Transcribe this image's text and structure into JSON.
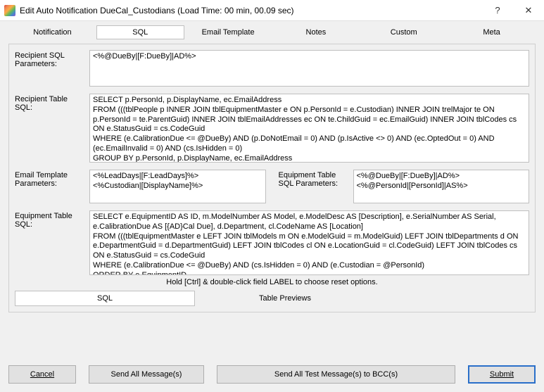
{
  "titlebar": {
    "title": "Edit Auto Notification DueCal_Custodians (Load Time: 00 min, 00.09 sec)",
    "help": "?",
    "close": "✕"
  },
  "tabs": {
    "notification": "Notification",
    "sql": "SQL",
    "email_template": "Email Template",
    "notes": "Notes",
    "custom": "Custom",
    "meta": "Meta"
  },
  "fields": {
    "recip_sql_params_label": "Recipient SQL Parameters:",
    "recip_sql_params_value": "<%@DueBy|[F:DueBy]|AD%>",
    "recip_table_sql_label": "Recipient Table SQL:",
    "recip_table_sql_value": "SELECT p.PersonId, p.DisplayName, ec.EmailAddress\nFROM (((tblPeople p INNER JOIN tblEquipmentMaster e ON p.PersonId = e.Custodian) INNER JOIN trelMajor te ON p.PersonId = te.ParentGuid) INNER JOIN tblEmailAddresses ec ON te.ChildGuid = ec.EmailGuid) INNER JOIN tblCodes cs ON e.StatusGuid = cs.CodeGuid\nWHERE (e.CalibrationDue <= @DueBy) AND (p.DoNotEmail = 0) AND (p.IsActive <> 0) AND (ec.OptedOut = 0) AND (ec.EmailInvalid = 0) AND (cs.IsHidden = 0)\nGROUP BY p.PersonId, p.DisplayName, ec.EmailAddress\nHAVING ec.EmailAddress IS NOT NULL\nORDER BY p.DisplayName",
    "email_tmpl_params_label": "Email Template Parameters:",
    "email_tmpl_params_value": "<%LeadDays|[F:LeadDays]%>\n<%Custodian|[DisplayName]%>",
    "equip_sql_params_label": "Equipment Table SQL Parameters:",
    "equip_sql_params_value": "<%@DueBy|[F:DueBy]|AD%>\n<%@PersonId|[PersonId]|AS%>",
    "equip_table_sql_label": "Equipment Table SQL:",
    "equip_table_sql_value": "SELECT e.EquipmentID AS ID, m.ModelNumber AS Model, e.ModelDesc AS [Description], e.SerialNumber AS Serial, e.CalibrationDue AS [{AD}Cal Due], d.Department, cl.CodeName AS [Location]\nFROM (((tblEquipmentMaster e LEFT JOIN tblModels m ON e.ModelGuid = m.ModelGuid) LEFT JOIN tblDepartments d ON e.DepartmentGuid = d.DepartmentGuid) LEFT JOIN tblCodes cl ON e.LocationGuid = cl.CodeGuid) LEFT JOIN tblCodes cs ON e.StatusGuid = cs.CodeGuid\nWHERE (e.CalibrationDue <= @DueBy) AND (cs.IsHidden = 0) AND (e.Custodian = @PersonId)\nORDER BY e.EquipmentID"
  },
  "hint": "Hold [Ctrl] & double-click field LABEL to choose reset options.",
  "subtabs": {
    "sql": "SQL",
    "table_previews": "Table Previews"
  },
  "buttons": {
    "cancel": "Cancel",
    "send_all": "Send All Message(s)",
    "send_test": "Send All Test Message(s) to BCC(s)",
    "submit": "Submit"
  }
}
